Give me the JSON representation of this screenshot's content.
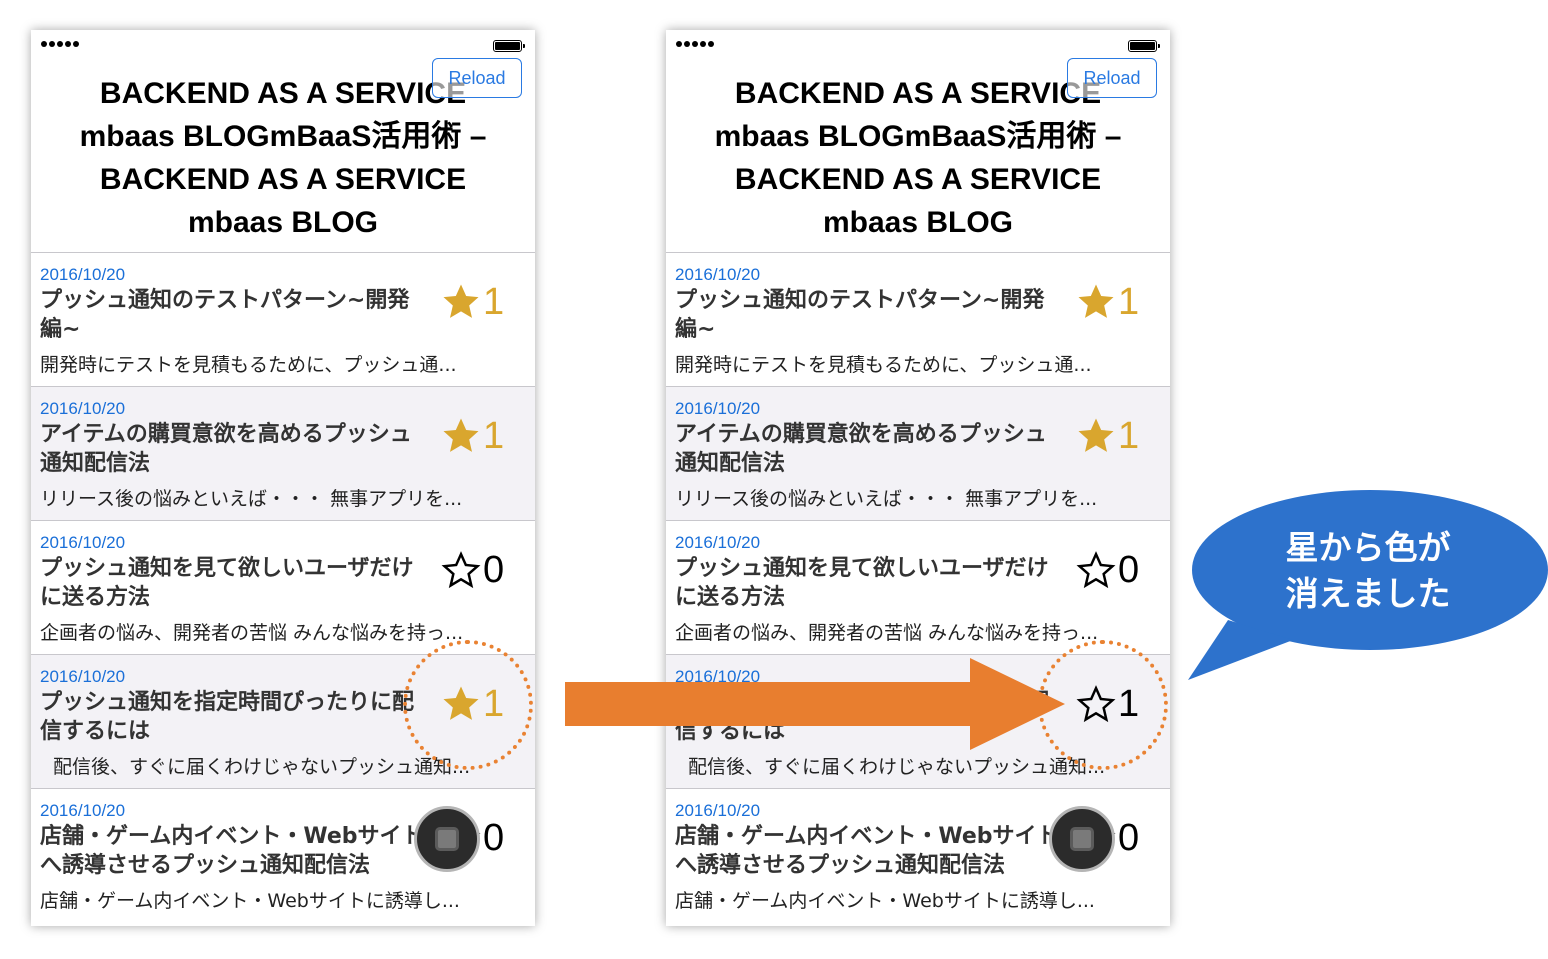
{
  "phones": [
    {
      "reload_label": "Reload",
      "title": "BACKEND AS A SERVICE\nmbaas BLOGmBaaS活用術 –\nBACKEND AS A SERVICE\nmbaas BLOG",
      "items": [
        {
          "date": "2016/10/20",
          "title": "プッシュ通知のテストパターン~開発編~",
          "excerpt": "開発時にテストを見積もるために、プッシュ通...",
          "count": "1",
          "starred": true
        },
        {
          "date": "2016/10/20",
          "title": "アイテムの購買意欲を高めるプッシュ通知配信法",
          "excerpt": "リリース後の悩みといえば・・・ 無事アプリを...",
          "count": "1",
          "starred": true
        },
        {
          "date": "2016/10/20",
          "title": "プッシュ通知を見て欲しいユーザだけに送る方法",
          "excerpt": "企画者の悩み、開発者の苦悩 みんな悩みを持っ...",
          "count": "0",
          "starred": false
        },
        {
          "date": "2016/10/20",
          "title": "プッシュ通知を指定時間ぴったりに配信するには",
          "excerpt": "配信後、すぐに届くわけじゃないプッシュ通知...",
          "count": "1",
          "starred": true
        },
        {
          "date": "2016/10/20",
          "title": "店舗・ゲーム内イベント・Webサイトへ誘導させるプッシュ通知配信法",
          "excerpt": "店舗・ゲーム内イベント・Webサイトに誘導し...",
          "count": "0",
          "starred": false
        }
      ]
    },
    {
      "reload_label": "Reload",
      "title": "BACKEND AS A SERVICE\nmbaas BLOGmBaaS活用術 –\nBACKEND AS A SERVICE\nmbaas BLOG",
      "items": [
        {
          "date": "2016/10/20",
          "title": "プッシュ通知のテストパターン~開発編~",
          "excerpt": "開発時にテストを見積もるために、プッシュ通...",
          "count": "1",
          "starred": true
        },
        {
          "date": "2016/10/20",
          "title": "アイテムの購買意欲を高めるプッシュ通知配信法",
          "excerpt": "リリース後の悩みといえば・・・ 無事アプリを...",
          "count": "1",
          "starred": true
        },
        {
          "date": "2016/10/20",
          "title": "プッシュ通知を見て欲しいユーザだけに送る方法",
          "excerpt": "企画者の悩み、開発者の苦悩 みんな悩みを持っ...",
          "count": "0",
          "starred": false
        },
        {
          "date": "2016/10/20",
          "title": "プッシュ通知を指定時間ぴったりに配信するには",
          "excerpt": "配信後、すぐに届くわけじゃないプッシュ通知...",
          "count": "1",
          "starred": false
        },
        {
          "date": "2016/10/20",
          "title": "店舗・ゲーム内イベント・Webサイトへ誘導させるプッシュ通知配信法",
          "excerpt": "店舗・ゲーム内イベント・Webサイトに誘導し...",
          "count": "0",
          "starred": false
        }
      ]
    }
  ],
  "callout": {
    "line1": "星から色が",
    "line2": "消えました"
  },
  "colors": {
    "star_gold": "#d9a62e",
    "link_blue": "#1a6fd8",
    "arrow_orange": "#e87e2f",
    "bubble_blue": "#2d72cc"
  }
}
